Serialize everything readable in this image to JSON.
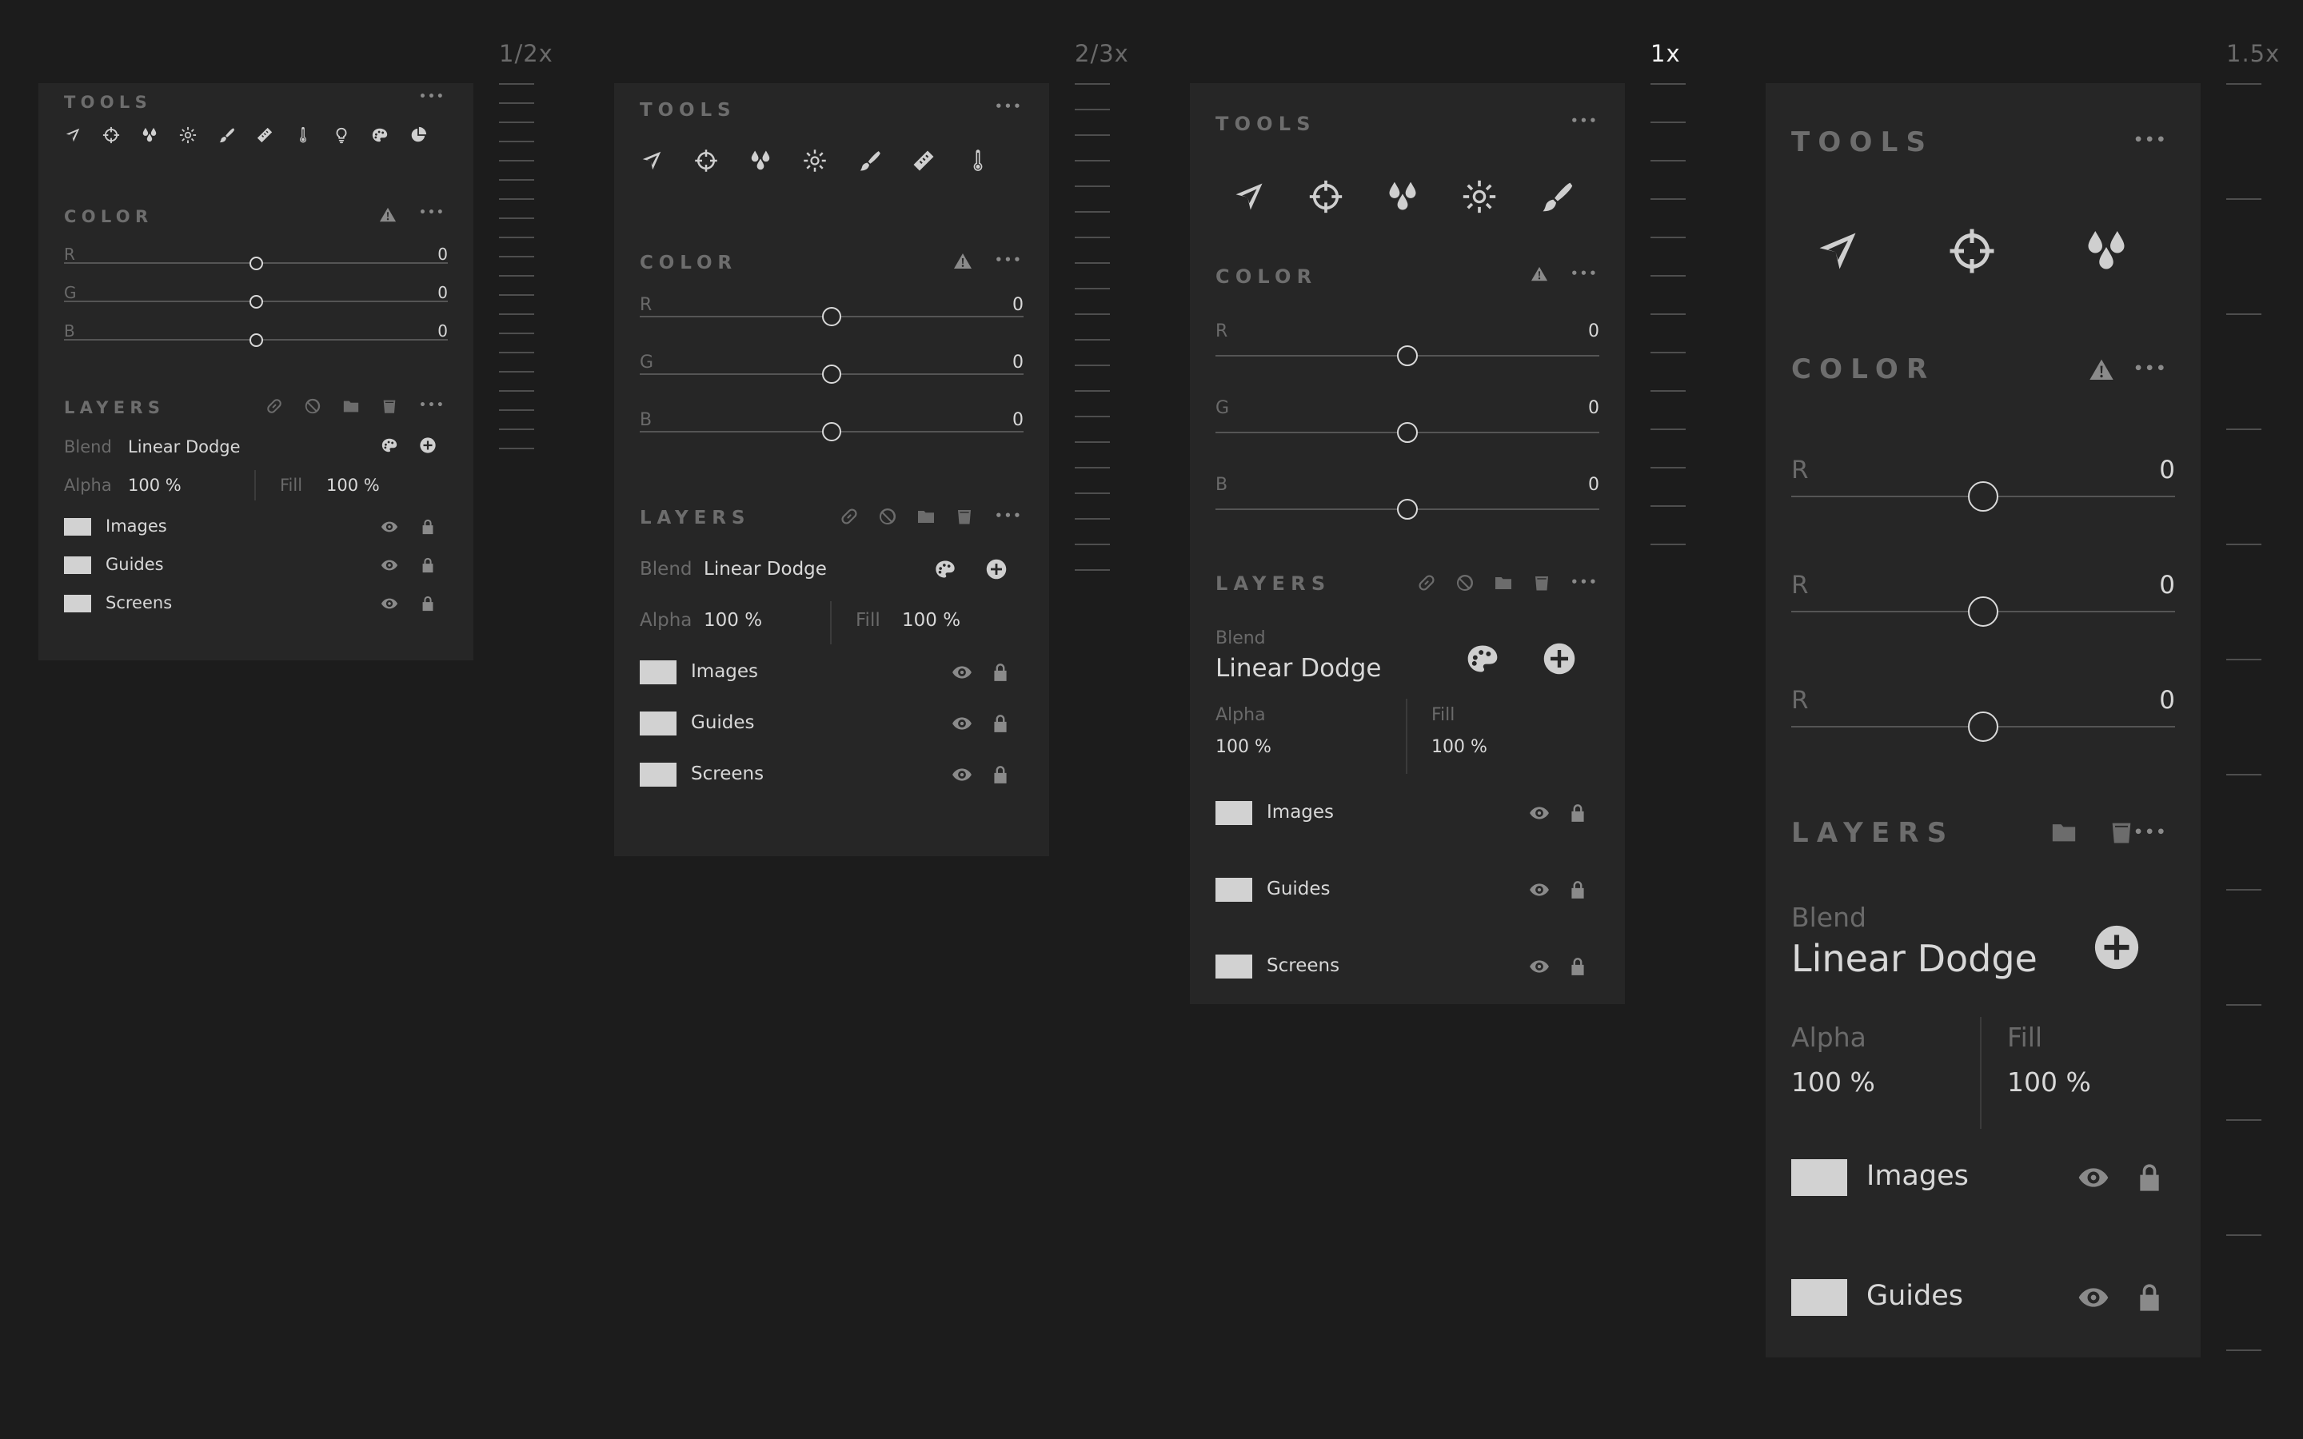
{
  "scales": [
    {
      "label": "1/2x",
      "active": false
    },
    {
      "label": "2/3x",
      "active": false
    },
    {
      "label": "1x",
      "active": true
    },
    {
      "label": "1.5x",
      "active": false
    }
  ],
  "common": {
    "tools_title": "TOOLS",
    "color_title": "COLOR",
    "layers_title": "LAYERS",
    "more_label": "•••",
    "blend_label": "Blend",
    "blend_value": "Linear Dodge",
    "alpha_label": "Alpha",
    "alpha_value": "100 %",
    "fill_label": "Fill",
    "fill_value": "100 %",
    "layer_names": [
      "Images",
      "Guides",
      "Screens"
    ]
  },
  "color_channels": {
    "half": [
      {
        "label": "R",
        "value": "0"
      },
      {
        "label": "G",
        "value": "0"
      },
      {
        "label": "B",
        "value": "0"
      }
    ],
    "twothirds": [
      {
        "label": "R",
        "value": "0"
      },
      {
        "label": "G",
        "value": "0"
      },
      {
        "label": "B",
        "value": "0"
      }
    ],
    "one": [
      {
        "label": "R",
        "value": "0"
      },
      {
        "label": "G",
        "value": "0"
      },
      {
        "label": "B",
        "value": "0"
      }
    ],
    "onehalf": [
      {
        "label": "R",
        "value": "0"
      },
      {
        "label": "R",
        "value": "0"
      },
      {
        "label": "R",
        "value": "0"
      }
    ]
  },
  "tools": {
    "half": [
      "navigate-icon",
      "crosshair-icon",
      "droplets-icon",
      "brightness-icon",
      "brush-icon",
      "ruler-icon",
      "thermometer-icon",
      "bulb-icon",
      "palette-icon",
      "pie-icon"
    ],
    "twothirds": [
      "navigate-icon",
      "crosshair-icon",
      "droplets-icon",
      "brightness-icon",
      "brush-icon",
      "ruler-icon",
      "thermometer-icon"
    ],
    "one": [
      "navigate-icon",
      "crosshair-icon",
      "droplets-icon",
      "brightness-icon",
      "brush-icon"
    ],
    "onehalf": [
      "navigate-icon",
      "crosshair-icon",
      "droplets-icon"
    ]
  },
  "slider_positions": {
    "r": 0.5,
    "g": 0.5,
    "b": 0.5
  },
  "colors": {
    "background": "#1c1c1c",
    "panel": "#262626",
    "text": "#d8d8d8",
    "muted": "#6a6a6a",
    "swatch": "#d2d2d2",
    "active_scale": "#f2f2f2"
  }
}
